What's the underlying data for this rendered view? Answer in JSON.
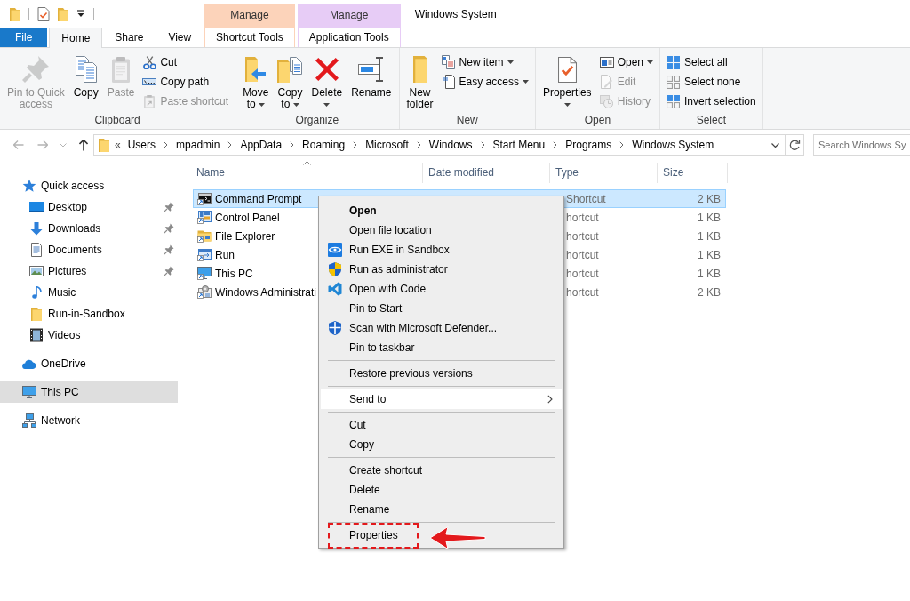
{
  "window": {
    "title": "Windows System"
  },
  "ribbon": {
    "tabs": [
      {
        "label": "File",
        "kind": "file",
        "selected": false
      },
      {
        "label": "Home",
        "kind": "tab",
        "selected": true
      },
      {
        "label": "Share",
        "kind": "tab",
        "selected": false
      },
      {
        "label": "View",
        "kind": "tab",
        "selected": false
      }
    ],
    "contextual_tabs": [
      {
        "header": "Manage",
        "color": "#fcd3ba",
        "label": "Shortcut Tools",
        "selected": false
      },
      {
        "header": "Manage",
        "color": "#e7ccf6",
        "label": "Application Tools",
        "selected": false
      }
    ],
    "groups": [
      {
        "label": "Clipboard",
        "commands": [
          {
            "label": "Pin to Quick access",
            "kind": "large",
            "disabled": true,
            "dropdown": false
          },
          {
            "label": "Copy",
            "kind": "large",
            "disabled": false,
            "dropdown": false
          },
          {
            "label": "Paste",
            "kind": "large",
            "disabled": true,
            "dropdown": false
          },
          {
            "label": "Cut",
            "kind": "small",
            "disabled": false,
            "dropdown": false
          },
          {
            "label": "Copy path",
            "kind": "small",
            "disabled": false,
            "dropdown": false
          },
          {
            "label": "Paste shortcut",
            "kind": "small",
            "disabled": true,
            "dropdown": false
          }
        ]
      },
      {
        "label": "Organize",
        "commands": [
          {
            "label": "Move to",
            "kind": "large",
            "disabled": false,
            "dropdown": true
          },
          {
            "label": "Copy to",
            "kind": "large",
            "disabled": false,
            "dropdown": true
          },
          {
            "label": "Delete",
            "kind": "large",
            "disabled": false,
            "dropdown": true
          },
          {
            "label": "Rename",
            "kind": "large",
            "disabled": false,
            "dropdown": false
          }
        ]
      },
      {
        "label": "New",
        "commands": [
          {
            "label": "New folder",
            "kind": "large",
            "disabled": false,
            "dropdown": false
          },
          {
            "label": "New item",
            "kind": "small",
            "disabled": false,
            "dropdown": true
          },
          {
            "label": "Easy access",
            "kind": "small",
            "disabled": false,
            "dropdown": true
          }
        ]
      },
      {
        "label": "Open",
        "commands": [
          {
            "label": "Properties",
            "kind": "large",
            "disabled": false,
            "dropdown": true
          },
          {
            "label": "Open",
            "kind": "small",
            "disabled": false,
            "dropdown": true
          },
          {
            "label": "Edit",
            "kind": "small",
            "disabled": true,
            "dropdown": false
          },
          {
            "label": "History",
            "kind": "small",
            "disabled": true,
            "dropdown": false
          }
        ]
      },
      {
        "label": "Select",
        "commands": [
          {
            "label": "Select all",
            "kind": "small",
            "disabled": false,
            "dropdown": false
          },
          {
            "label": "Select none",
            "kind": "small",
            "disabled": false,
            "dropdown": false
          },
          {
            "label": "Invert selection",
            "kind": "small",
            "disabled": false,
            "dropdown": false
          }
        ]
      }
    ]
  },
  "address_bar": {
    "overflow": "«",
    "path": [
      "Users",
      "mpadmin",
      "AppData",
      "Roaming",
      "Microsoft",
      "Windows",
      "Start Menu",
      "Programs",
      "Windows System"
    ]
  },
  "search": {
    "placeholder": "Search Windows Sy"
  },
  "sidebar": {
    "items": [
      {
        "label": "Quick access",
        "selected": false,
        "pinned": false,
        "children": [
          {
            "label": "Desktop",
            "selected": false,
            "pinned": true
          },
          {
            "label": "Downloads",
            "selected": false,
            "pinned": true
          },
          {
            "label": "Documents",
            "selected": false,
            "pinned": true
          },
          {
            "label": "Pictures",
            "selected": false,
            "pinned": true
          },
          {
            "label": "Music",
            "selected": false,
            "pinned": false
          },
          {
            "label": "Run-in-Sandbox",
            "selected": false,
            "pinned": false
          },
          {
            "label": "Videos",
            "selected": false,
            "pinned": false
          }
        ]
      },
      {
        "label": "OneDrive",
        "selected": false,
        "pinned": false
      },
      {
        "label": "This PC",
        "selected": true,
        "pinned": false
      },
      {
        "label": "Network",
        "selected": false,
        "pinned": false
      }
    ]
  },
  "file_list": {
    "columns": [
      {
        "label": "Name",
        "sorted": true
      },
      {
        "label": "Date modified",
        "sorted": false
      },
      {
        "label": "Type",
        "sorted": false
      },
      {
        "label": "Size",
        "sorted": false
      }
    ],
    "rows": [
      {
        "name": "Command Prompt",
        "type": "Shortcut",
        "size": "2 KB",
        "selected": true
      },
      {
        "name": "Control Panel",
        "type": "hortcut",
        "size": "1 KB",
        "selected": false
      },
      {
        "name": "File Explorer",
        "type": "hortcut",
        "size": "1 KB",
        "selected": false
      },
      {
        "name": "Run",
        "type": "hortcut",
        "size": "1 KB",
        "selected": false
      },
      {
        "name": "This PC",
        "type": "hortcut",
        "size": "1 KB",
        "selected": false
      },
      {
        "name": "Windows Administrati",
        "type": "hortcut",
        "size": "2 KB",
        "selected": false
      }
    ]
  },
  "context_menu": {
    "sections": [
      {
        "items": [
          {
            "label": "Open",
            "kind": "default",
            "selected": false,
            "callout": false
          },
          {
            "label": "Open file location",
            "kind": "plain",
            "selected": false,
            "callout": false
          },
          {
            "label": "Run EXE in Sandbox",
            "kind": "icon",
            "selected": false,
            "callout": false
          },
          {
            "label": "Run as administrator",
            "kind": "icon",
            "selected": false,
            "callout": false
          },
          {
            "label": "Open with Code",
            "kind": "icon",
            "selected": false,
            "callout": false
          },
          {
            "label": "Pin to Start",
            "kind": "plain",
            "selected": false,
            "callout": false
          },
          {
            "label": "Scan with Microsoft Defender...",
            "kind": "icon",
            "selected": false,
            "callout": false
          },
          {
            "label": "Pin to taskbar",
            "kind": "plain",
            "selected": false,
            "callout": false
          }
        ]
      },
      {
        "items": [
          {
            "label": "Restore previous versions",
            "kind": "plain",
            "selected": false,
            "callout": false
          }
        ]
      },
      {
        "items": [
          {
            "label": "Send to",
            "kind": "submenu",
            "selected": true,
            "callout": false
          }
        ]
      },
      {
        "items": [
          {
            "label": "Cut",
            "kind": "plain",
            "selected": false,
            "callout": false
          },
          {
            "label": "Copy",
            "kind": "plain",
            "selected": false,
            "callout": false
          }
        ]
      },
      {
        "items": [
          {
            "label": "Create shortcut",
            "kind": "plain",
            "selected": false,
            "callout": false
          },
          {
            "label": "Delete",
            "kind": "plain",
            "selected": false,
            "callout": false
          },
          {
            "label": "Rename",
            "kind": "plain",
            "selected": false,
            "callout": false
          }
        ]
      },
      {
        "items": [
          {
            "label": "Properties",
            "kind": "plain",
            "selected": false,
            "callout": true
          }
        ]
      }
    ]
  }
}
